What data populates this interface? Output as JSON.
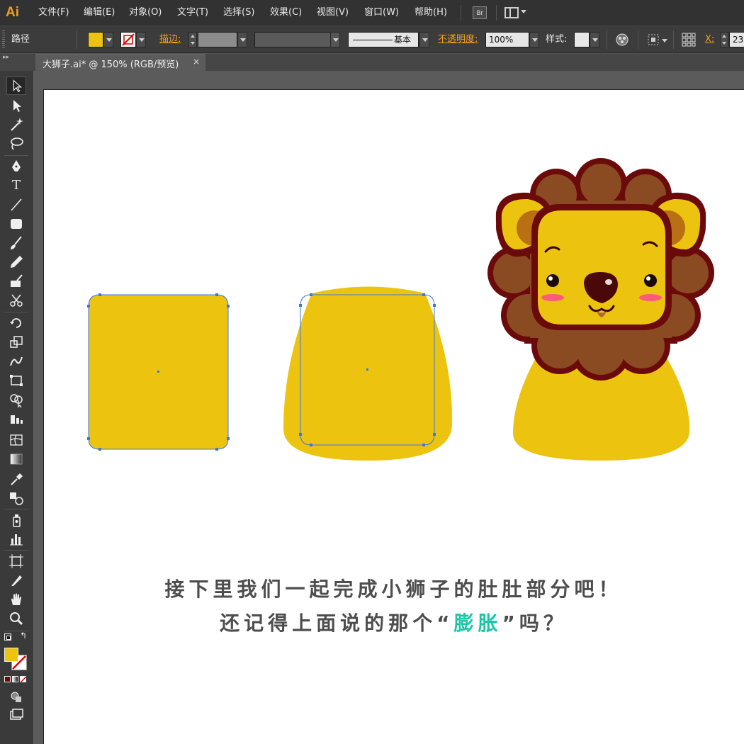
{
  "app": {
    "logo": "Ai",
    "bridge_label": "Br"
  },
  "menu": [
    "文件(F)",
    "编辑(E)",
    "对象(O)",
    "文字(T)",
    "选择(S)",
    "效果(C)",
    "视图(V)",
    "窗口(W)",
    "帮助(H)"
  ],
  "control": {
    "object_type": "路径",
    "stroke_label": "描边:",
    "stroke_style": "基本",
    "opacity_label": "不透明度:",
    "opacity_value": "100%",
    "style_label": "样式:",
    "x_label": "X:",
    "x_value": "23"
  },
  "tab": {
    "title": "大狮子.ai* @ 150% (RGB/预览)",
    "close": "×"
  },
  "colors": {
    "fill": "#ecc30e",
    "selection": "#3a78e0",
    "mane_outline": "#6b0a0a",
    "mane": "#8a4a22",
    "face": "#ecc30e",
    "ear_inner": "#b87012",
    "blush": "#ff5a7a",
    "highlight_text": "#19c7a7",
    "caption_text": "#4d4d4d"
  },
  "tools": [
    "selection-tool",
    "direct-selection-tool",
    "magic-wand-tool",
    "lasso-tool",
    "pen-tool",
    "type-tool",
    "line-tool",
    "rectangle-tool",
    "paintbrush-tool",
    "pencil-tool",
    "blob-brush-tool",
    "scissors-tool",
    "rotate-tool",
    "scale-tool",
    "warp-tool",
    "free-transform-tool",
    "shape-builder-tool",
    "perspective-grid-tool",
    "mesh-tool",
    "gradient-tool",
    "eyedropper-tool",
    "blend-tool",
    "symbol-sprayer-tool",
    "column-graph-tool",
    "artboard-tool",
    "slice-tool",
    "hand-tool",
    "zoom-tool"
  ],
  "caption": {
    "line1": "接下里我们一起完成小狮子的肚肚部分吧！",
    "line2_before": "还记得上面说的那个",
    "line2_open_quote": "“",
    "line2_highlight": "膨胀",
    "line2_close_quote": "”",
    "line2_after": "吗？"
  }
}
